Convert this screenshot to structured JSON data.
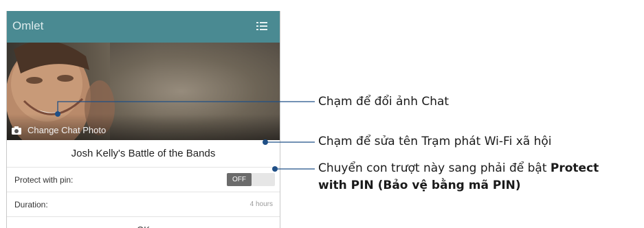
{
  "app": {
    "title": "Omlet",
    "menu_icon": "list-icon"
  },
  "photo": {
    "camera_icon": "camera-icon",
    "change_label": "Change Chat Photo"
  },
  "chat": {
    "name": "Josh Kelly's Battle of the Bands"
  },
  "pin": {
    "label": "Protect with pin:",
    "toggle_state": "OFF"
  },
  "duration": {
    "label": "Duration:",
    "value": "4 hours"
  },
  "ok_label": "OK",
  "callouts": {
    "photo": "Chạm để đổi ảnh Chat",
    "name": "Chạm để sửa tên Trạm phát Wi-Fi xã hội",
    "pin_line1_plain": "Chuyển con trượt này sang phải để bật ",
    "pin_line1_bold": "Protect",
    "pin_line2_bold": "with PIN (Bảo vệ bằng mã PIN)"
  },
  "colors": {
    "appbar": "#4a8a92",
    "toggle_knob": "#6b6b6b",
    "callout_line": "#1f4f86"
  }
}
